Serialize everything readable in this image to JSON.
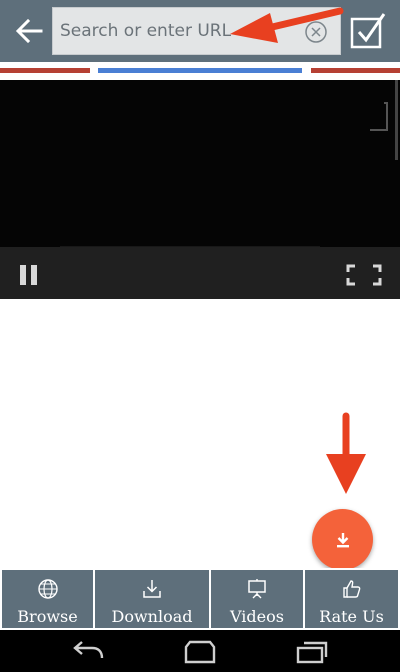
{
  "toolbar": {
    "back_icon": "arrow-left-icon",
    "search": {
      "placeholder": "Search or enter URL",
      "value": ""
    },
    "clear_icon": "circle-x-icon",
    "check_icon": "checkbox-check-icon"
  },
  "colors": {
    "toolbar": "#5e6f7b",
    "accent_red": "#b64033",
    "accent_blue": "#4a7fd4",
    "fab": "#f4623a",
    "annotation_arrow": "#e84020"
  },
  "video": {
    "pause_icon": "pause-icon",
    "fullscreen_icon": "fullscreen-icon"
  },
  "fab": {
    "icon": "download-icon"
  },
  "tabs": [
    {
      "label": "Browse",
      "icon": "globe-icon"
    },
    {
      "label": "Download",
      "icon": "download-tray-icon"
    },
    {
      "label": "Videos",
      "icon": "presentation-board-icon"
    },
    {
      "label": "Rate Us",
      "icon": "thumbs-up-icon"
    }
  ],
  "system_nav": {
    "back": "nav-back-icon",
    "home": "nav-home-icon",
    "recents": "nav-recents-icon"
  }
}
